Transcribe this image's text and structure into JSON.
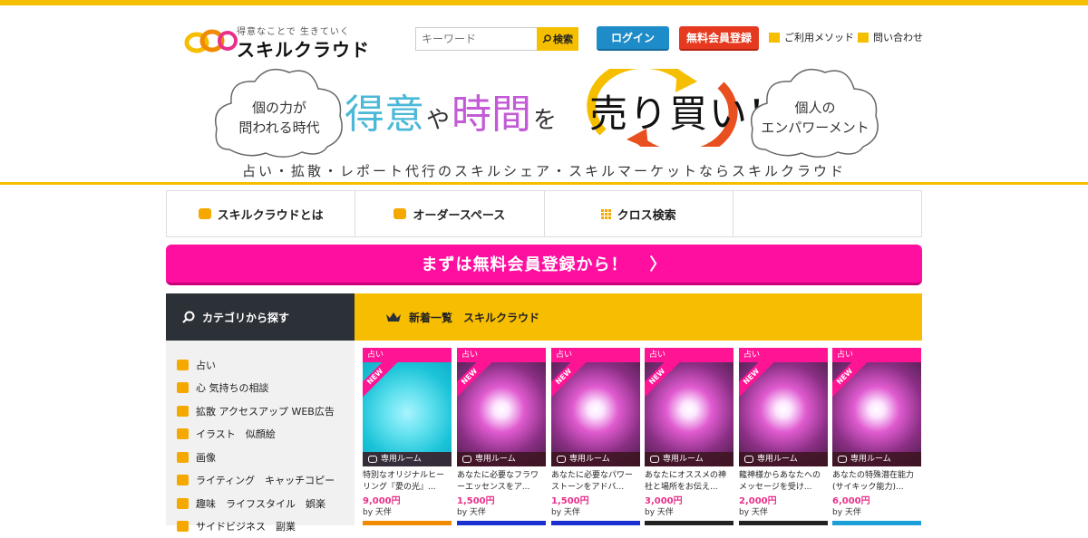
{
  "header": {
    "logo_tag": "得意なことで 生きていく",
    "logo_name": "スキルクラウド",
    "search_placeholder": "キーワード",
    "search_button": "検索",
    "login_button": "ログイン",
    "register_button": "無料会員登録",
    "method_link": "ご利用メソッド",
    "contact_link": "問い合わせ"
  },
  "banner": {
    "left_cloud": [
      "個の力が",
      "問われる時代"
    ],
    "right_cloud": [
      "個人の",
      "エンパワーメント"
    ],
    "tagline": [
      "得意",
      "や",
      "時間",
      "を"
    ],
    "swap_text": "売り買い!",
    "subcopy": "占い・拡散・レポート代行のスキルシェア・スキルマーケットならスキルクラウド"
  },
  "nav": {
    "items": [
      "スキルクラウドとは",
      "オーダースペース",
      "クロス検索",
      ""
    ]
  },
  "cta": {
    "label": "まずは無料会員登録から！",
    "arrow": "〉"
  },
  "sidebar": {
    "title": "カテゴリから探す",
    "items": [
      "占い",
      "心 気持ちの相談",
      "拡散 アクセスアップ WEB広告",
      "イラスト　似顔絵",
      "画像",
      "ライティング　キャッチコピー",
      "趣味　ライフスタイル　娯楽",
      "サイドビジネス　副業"
    ]
  },
  "main": {
    "title": "新着一覧　スキルクラウド",
    "cards": [
      {
        "category": "占い",
        "badge": "NEW",
        "room": "専用ルーム",
        "title": "特別なオリジナルヒーリング『愛の光』...",
        "price": "9,000円",
        "by": "by 天伴"
      },
      {
        "category": "占い",
        "badge": "NEW",
        "room": "専用ルーム",
        "title": "あなたに必要なフラワーエッセンスをア...",
        "price": "1,500円",
        "by": "by 天伴"
      },
      {
        "category": "占い",
        "badge": "NEW",
        "room": "専用ルーム",
        "title": "あなたに必要なパワーストーンをアドバ...",
        "price": "1,500円",
        "by": "by 天伴"
      },
      {
        "category": "占い",
        "badge": "NEW",
        "room": "専用ルーム",
        "title": "あなたにオススメの神社と場所をお伝え...",
        "price": "3,000円",
        "by": "by 天伴"
      },
      {
        "category": "占い",
        "badge": "NEW",
        "room": "専用ルーム",
        "title": "龍神様からあなたへのメッセージを受け...",
        "price": "2,000円",
        "by": "by 天伴"
      },
      {
        "category": "占い",
        "badge": "NEW",
        "room": "専用ルーム",
        "title": "あなたの特殊潜在能力(サイキック能力)...",
        "price": "6,000円",
        "by": "by 天伴"
      }
    ]
  },
  "colors": {
    "brand_yellow": "#f5bf00",
    "cta_pink": "#ff0fa0",
    "login_blue": "#1e8cc8",
    "register_red": "#e53a1f",
    "sidebar_dark": "#2c3138"
  }
}
